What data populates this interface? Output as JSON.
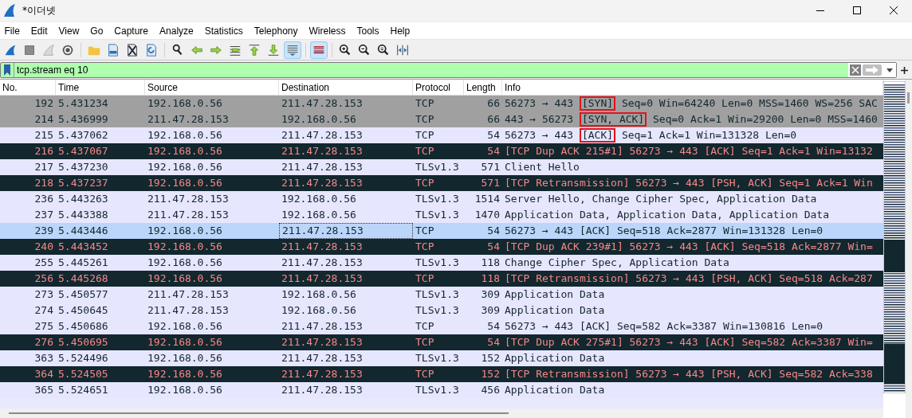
{
  "window": {
    "title": "*이더넷"
  },
  "menu": [
    "File",
    "Edit",
    "View",
    "Go",
    "Capture",
    "Analyze",
    "Statistics",
    "Telephony",
    "Wireless",
    "Tools",
    "Help"
  ],
  "toolbar": [
    [
      {
        "kind": "start",
        "pressed": false
      },
      {
        "kind": "stop",
        "pressed": false
      },
      {
        "kind": "restart",
        "pressed": false
      },
      {
        "kind": "options",
        "pressed": false
      }
    ],
    [
      {
        "kind": "open",
        "pressed": false
      },
      {
        "kind": "save",
        "pressed": false
      },
      {
        "kind": "close",
        "pressed": false
      },
      {
        "kind": "reload",
        "pressed": false
      }
    ],
    [
      {
        "kind": "find",
        "pressed": false
      },
      {
        "kind": "back",
        "pressed": false
      },
      {
        "kind": "forward",
        "pressed": false
      },
      {
        "kind": "goto",
        "pressed": false
      },
      {
        "kind": "first",
        "pressed": false
      },
      {
        "kind": "last",
        "pressed": false
      },
      {
        "kind": "autoscroll",
        "pressed": true
      }
    ],
    [
      {
        "kind": "colorize",
        "pressed": true
      }
    ],
    [
      {
        "kind": "zoom-in",
        "pressed": false
      },
      {
        "kind": "zoom-out",
        "pressed": false
      },
      {
        "kind": "zoom-reset",
        "pressed": false
      },
      {
        "kind": "resize",
        "pressed": false
      }
    ]
  ],
  "filter": {
    "value": "tcp.stream eq 10"
  },
  "columns": [
    "No.",
    "Time",
    "Source",
    "Destination",
    "Protocol",
    "Length",
    "Info"
  ],
  "rows": [
    {
      "kind": "handshake",
      "selected": false,
      "cells": [
        "192",
        "5.431234",
        "192.168.0.56",
        "211.47.28.153",
        "TCP",
        "66"
      ],
      "info": [
        {
          "text": "56273 → 443 ",
          "boxed": false
        },
        {
          "text": "[SYN]",
          "boxed": true
        },
        {
          "text": " Seq=0 Win=64240 Len=0 MSS=1460 WS=256 SAC",
          "boxed": false
        }
      ]
    },
    {
      "kind": "handshake",
      "selected": false,
      "cells": [
        "214",
        "5.436999",
        "211.47.28.153",
        "192.168.0.56",
        "TCP",
        "66"
      ],
      "info": [
        {
          "text": "443 → 56273 ",
          "boxed": false
        },
        {
          "text": "[SYN, ACK]",
          "boxed": true
        },
        {
          "text": " Seq=0 Ack=1 Win=29200 Len=0 MSS=1460",
          "boxed": false
        }
      ]
    },
    {
      "kind": "normal",
      "selected": false,
      "cells": [
        "215",
        "5.437062",
        "192.168.0.56",
        "211.47.28.153",
        "TCP",
        "54"
      ],
      "info": [
        {
          "text": "56273 → 443 ",
          "boxed": false
        },
        {
          "text": "[ACK]",
          "boxed": true
        },
        {
          "text": " Seq=1 Ack=1 Win=131328 Len=0",
          "boxed": false
        }
      ]
    },
    {
      "kind": "error",
      "selected": false,
      "cells": [
        "216",
        "5.437067",
        "192.168.0.56",
        "211.47.28.153",
        "TCP",
        "54"
      ],
      "info": [
        {
          "text": "[TCP Dup ACK 215#1] 56273 → 443 [ACK] Seq=1 Ack=1 Win=13132",
          "boxed": false
        }
      ]
    },
    {
      "kind": "normal",
      "selected": false,
      "cells": [
        "217",
        "5.437230",
        "192.168.0.56",
        "211.47.28.153",
        "TLSv1.3",
        "571"
      ],
      "info": [
        {
          "text": "Client Hello",
          "boxed": false
        }
      ]
    },
    {
      "kind": "error",
      "selected": false,
      "cells": [
        "218",
        "5.437237",
        "192.168.0.56",
        "211.47.28.153",
        "TCP",
        "571"
      ],
      "info": [
        {
          "text": "[TCP Retransmission] 56273 → 443 [PSH, ACK] Seq=1 Ack=1 Win",
          "boxed": false
        }
      ]
    },
    {
      "kind": "normal",
      "selected": false,
      "cells": [
        "236",
        "5.443263",
        "211.47.28.153",
        "192.168.0.56",
        "TLSv1.3",
        "1514"
      ],
      "info": [
        {
          "text": "Server Hello, Change Cipher Spec, Application Data",
          "boxed": false
        }
      ]
    },
    {
      "kind": "normal",
      "selected": false,
      "cells": [
        "237",
        "5.443388",
        "211.47.28.153",
        "192.168.0.56",
        "TLSv1.3",
        "1470"
      ],
      "info": [
        {
          "text": "Application Data, Application Data, Application Data",
          "boxed": false
        }
      ]
    },
    {
      "kind": "normal",
      "selected": true,
      "cells": [
        "239",
        "5.443446",
        "192.168.0.56",
        "211.47.28.153",
        "TCP",
        "54"
      ],
      "info": [
        {
          "text": "56273 → 443 [ACK] Seq=518 Ack=2877 Win=131328 Len=0",
          "boxed": false
        }
      ]
    },
    {
      "kind": "error",
      "selected": false,
      "cells": [
        "240",
        "5.443452",
        "192.168.0.56",
        "211.47.28.153",
        "TCP",
        "54"
      ],
      "info": [
        {
          "text": "[TCP Dup ACK 239#1] 56273 → 443 [ACK] Seq=518 Ack=2877 Win=",
          "boxed": false
        }
      ]
    },
    {
      "kind": "normal",
      "selected": false,
      "cells": [
        "255",
        "5.445261",
        "192.168.0.56",
        "211.47.28.153",
        "TLSv1.3",
        "118"
      ],
      "info": [
        {
          "text": "Change Cipher Spec, Application Data",
          "boxed": false
        }
      ]
    },
    {
      "kind": "error",
      "selected": false,
      "cells": [
        "256",
        "5.445268",
        "192.168.0.56",
        "211.47.28.153",
        "TCP",
        "118"
      ],
      "info": [
        {
          "text": "[TCP Retransmission] 56273 → 443 [PSH, ACK] Seq=518 Ack=287",
          "boxed": false
        }
      ]
    },
    {
      "kind": "normal",
      "selected": false,
      "cells": [
        "273",
        "5.450577",
        "211.47.28.153",
        "192.168.0.56",
        "TLSv1.3",
        "309"
      ],
      "info": [
        {
          "text": "Application Data",
          "boxed": false
        }
      ]
    },
    {
      "kind": "normal",
      "selected": false,
      "cells": [
        "274",
        "5.450645",
        "211.47.28.153",
        "192.168.0.56",
        "TLSv1.3",
        "309"
      ],
      "info": [
        {
          "text": "Application Data",
          "boxed": false
        }
      ]
    },
    {
      "kind": "normal",
      "selected": false,
      "cells": [
        "275",
        "5.450686",
        "192.168.0.56",
        "211.47.28.153",
        "TCP",
        "54"
      ],
      "info": [
        {
          "text": "56273 → 443 [ACK] Seq=582 Ack=3387 Win=130816 Len=0",
          "boxed": false
        }
      ]
    },
    {
      "kind": "error",
      "selected": false,
      "cells": [
        "276",
        "5.450695",
        "192.168.0.56",
        "211.47.28.153",
        "TCP",
        "54"
      ],
      "info": [
        {
          "text": "[TCP Dup ACK 275#1] 56273 → 443 [ACK] Seq=582 Ack=3387 Win=",
          "boxed": false
        }
      ]
    },
    {
      "kind": "normal",
      "selected": false,
      "cells": [
        "363",
        "5.524496",
        "192.168.0.56",
        "211.47.28.153",
        "TLSv1.3",
        "152"
      ],
      "info": [
        {
          "text": "Application Data",
          "boxed": false
        }
      ]
    },
    {
      "kind": "error",
      "selected": false,
      "cells": [
        "364",
        "5.524505",
        "192.168.0.56",
        "211.47.28.153",
        "TCP",
        "152"
      ],
      "info": [
        {
          "text": "[TCP Retransmission] 56273 → 443 [PSH, ACK] Seq=582 Ack=338",
          "boxed": false
        }
      ]
    },
    {
      "kind": "normal",
      "selected": false,
      "cells": [
        "365",
        "5.524651",
        "192.168.0.56",
        "211.47.28.153",
        "TLSv1.3",
        "456"
      ],
      "info": [
        {
          "text": "Application Data",
          "boxed": false
        }
      ]
    }
  ]
}
